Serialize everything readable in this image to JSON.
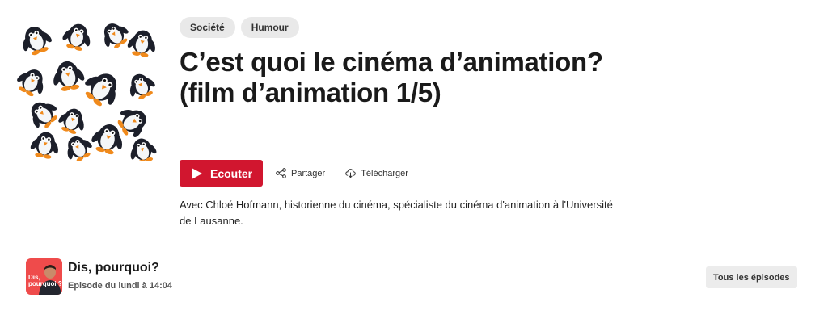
{
  "episode": {
    "tags": [
      "Société",
      "Humour"
    ],
    "title": "C’est quoi le cinéma d’animation? (film d’animation 1/5)",
    "actions": {
      "listen_label": "Ecouter",
      "share_label": "Partager",
      "download_label": "Télécharger"
    },
    "description": "Avec Chloé Hofmann, historienne du cinéma, spécialiste du cinéma d'animation à l'Université de Lausanne."
  },
  "show": {
    "name": "Dis, pourquoi?",
    "schedule": "Episode du lundi à 14:04",
    "thumb_text": "Dis, pourquoi ?",
    "all_episodes_label": "Tous les épisodes"
  },
  "colors": {
    "accent": "#d1162f",
    "thumb_bg": "#ef4b4b"
  },
  "icons": {
    "play": "play-icon",
    "share": "share-icon",
    "download": "cloud-download-icon"
  }
}
